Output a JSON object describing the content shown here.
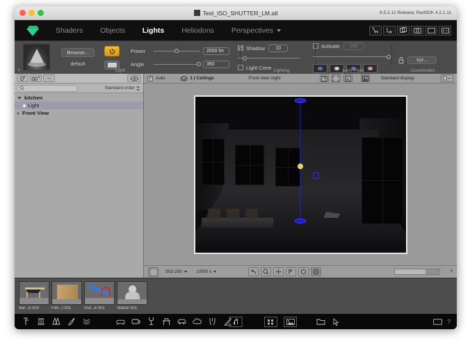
{
  "window": {
    "title": "Test_ISO_SHUTTER_LM.atl",
    "version": "6.5.2.12 Release; RedSDK 4.2.1.11"
  },
  "menubar": {
    "tabs": [
      {
        "label": "Shaders",
        "active": false
      },
      {
        "label": "Objects",
        "active": false
      },
      {
        "label": "Lights",
        "active": true
      },
      {
        "label": "Heliodons",
        "active": false
      },
      {
        "label": "Perspectives",
        "active": false,
        "has_caret": true
      }
    ],
    "tools": [
      {
        "name": "cart-icon"
      },
      {
        "name": "import-arrow-icon"
      },
      {
        "name": "duplicate-icon"
      },
      {
        "name": "camera-icon"
      },
      {
        "name": "window-icon"
      },
      {
        "name": "panel-icon"
      }
    ]
  },
  "properties": {
    "light_section": {
      "label": "Light",
      "browse_label": "Browse...",
      "preset_name": "default",
      "power_label": "Power",
      "power_value": "2000 lm",
      "angle_label": "Angle",
      "angle_value": "360",
      "help": "?"
    },
    "lighting_section": {
      "label": "Lighting",
      "shadow_label": "Shadow",
      "shadow_checked": true,
      "shadow_value": "10",
      "light_cone_label": "Light Cone",
      "light_cone_checked": false
    },
    "lens_flare_section": {
      "label": "Lens Flare",
      "activate_label": "Activate",
      "activate_checked": false,
      "activate_value": "100",
      "flares": [
        {
          "name": "flare-preset-1",
          "color": "#5a7ad0"
        },
        {
          "name": "flare-preset-2",
          "color": "#d8d8e8"
        },
        {
          "name": "flare-preset-3",
          "color": "#6a6ad8"
        },
        {
          "name": "flare-preset-4",
          "color": "#d8a0a8"
        }
      ]
    },
    "coordinates_section": {
      "label": "Coordinates",
      "xyz_label": "xyz..."
    }
  },
  "tree": {
    "toolbar": [
      {
        "name": "add-light-icon"
      },
      {
        "name": "add-multi-light-icon"
      },
      {
        "name": "remove-icon",
        "label": "–"
      },
      {
        "name": "visibility-eye-icon"
      }
    ],
    "search_placeholder": "",
    "order_label": "Standard order",
    "nodes": [
      {
        "label": "kitchen",
        "level": 0,
        "expanded": true,
        "selected": false
      },
      {
        "label": "Light",
        "level": 1,
        "expanded": false,
        "selected": true
      },
      {
        "label": "Front View",
        "level": 0,
        "expanded": false,
        "selected": false
      }
    ]
  },
  "viewport": {
    "header": {
      "auto_label": "Auto",
      "auto_checked": true,
      "layer_label": "1 | Ceilings",
      "view_label": "Front view night",
      "display_label": "Standard display",
      "icons": [
        {
          "name": "fit-frame-icon"
        },
        {
          "name": "select-frame-icon"
        },
        {
          "name": "crop-frame-icon"
        },
        {
          "name": "render-display-icon"
        }
      ]
    },
    "footer": {
      "iso_label": "ISO 200",
      "shutter_label": "1/500 s",
      "nav_icons": [
        {
          "name": "undo-icon"
        },
        {
          "name": "zoom-icon"
        },
        {
          "name": "pan-icon"
        },
        {
          "name": "walk-icon"
        },
        {
          "name": "orbit-icon"
        },
        {
          "name": "info-icon"
        }
      ],
      "help": "?"
    }
  },
  "library": {
    "items": [
      {
        "caption": "Bar...e 003",
        "name": "bar-stool-thumb"
      },
      {
        "caption": "Fen...l 001",
        "name": "wood-panel-thumb"
      },
      {
        "caption": "Out...e 001",
        "name": "slide-thumb"
      },
      {
        "caption": "Statue 001",
        "name": "statue-thumb"
      }
    ]
  },
  "bottombar": {
    "left_icons": [
      {
        "name": "spot-light-icon"
      },
      {
        "name": "street-light-icon"
      },
      {
        "name": "double-light-icon"
      },
      {
        "name": "desk-lamp-icon"
      },
      {
        "name": "water-icon"
      }
    ],
    "mid_icons": [
      {
        "name": "sofa-icon"
      },
      {
        "name": "tv-icon"
      },
      {
        "name": "plant-icon"
      },
      {
        "name": "table-icon"
      },
      {
        "name": "car-icon"
      },
      {
        "name": "cloud-icon"
      },
      {
        "name": "person-icon"
      },
      {
        "name": "stairs-icon"
      }
    ],
    "right_icons": [
      {
        "name": "grid-icon"
      },
      {
        "name": "image-icon"
      },
      {
        "name": "folder-icon"
      },
      {
        "name": "cursor-icon"
      }
    ],
    "hand_icon": {
      "name": "hand-tool-icon"
    },
    "end_icons": [
      {
        "name": "window-frame-icon"
      }
    ],
    "help": "?"
  }
}
